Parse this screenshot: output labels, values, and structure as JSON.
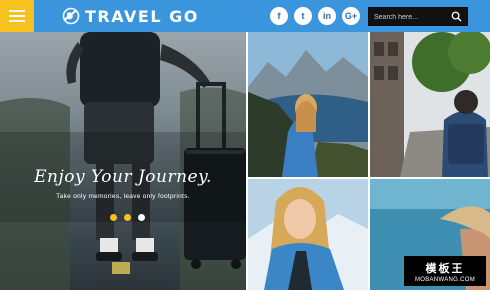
{
  "header": {
    "site_title": "TRAVEL GO",
    "search_placeholder": "Search here...",
    "social": [
      {
        "name": "facebook",
        "glyph": "f"
      },
      {
        "name": "twitter",
        "glyph": "t"
      },
      {
        "name": "linkedin",
        "glyph": "in"
      },
      {
        "name": "google-plus",
        "glyph": "G+"
      }
    ]
  },
  "hero": {
    "title": "Enjoy Your Journey.",
    "subtitle": "Take only memories, leave only footprints.",
    "slides": 3,
    "active_slide": 3
  },
  "gallery": [
    {
      "subject": "woman-mountain-lake"
    },
    {
      "subject": "man-backpack-city"
    },
    {
      "subject": "woman-blonde-jacket"
    },
    {
      "subject": "sea-hat"
    }
  ],
  "watermark": {
    "title": "模板王",
    "url": "MOBANWANG.COM"
  },
  "colors": {
    "header_bg": "#3b95dd",
    "menu_bg": "#f7c21f",
    "dot_color": "#f7c21f"
  }
}
